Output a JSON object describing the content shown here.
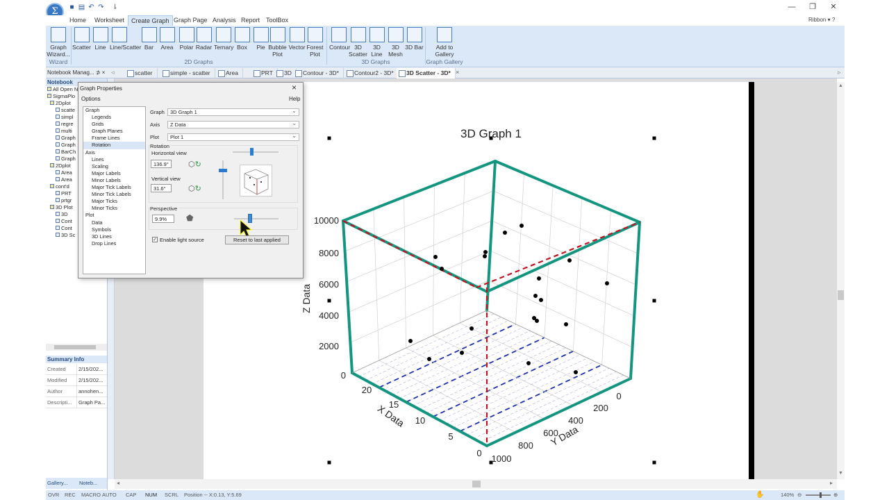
{
  "app": {
    "icon_glyph": "Σ",
    "ribbon_toggle": "Ribbon"
  },
  "menu": {
    "tabs": [
      "Home",
      "Worksheet",
      "Create Graph",
      "Graph Page",
      "Analysis",
      "Report",
      "ToolBox"
    ],
    "active": "Create Graph"
  },
  "ribbon": {
    "wizard_buttons": [
      {
        "label": "Graph Wizard...",
        "icon": "graph-wizard-icon"
      }
    ],
    "graph2d_buttons": [
      "Scatter",
      "Line",
      "Line/Scatter",
      "Bar",
      "Area",
      "Polar",
      "Radar",
      "Ternary",
      "Box",
      "Pie",
      "Bubble Plot",
      "Vector",
      "Forest Plot"
    ],
    "graph3d_buttons": [
      "Contour",
      "3D Scatter",
      "3D Line",
      "3D Mesh",
      "3D Bar"
    ],
    "gallery_buttons": [
      "Add to Gallery"
    ],
    "groups": {
      "wizard": "Wizard",
      "graph2d": "2D Graphs",
      "graph3d": "3D Graphs",
      "gallery": "Graph Gallery"
    }
  },
  "doc_tabs": {
    "pane_title": "Notebook Manag...",
    "pin": "⊅",
    "close": "×",
    "items": [
      "scatter",
      "simple - scatter",
      "Area",
      "PRT",
      "3D",
      "Contour - 3D*",
      "Contour2 - 3D*",
      "3D Scatter - 3D*"
    ],
    "active": "3D Scatter - 3D*"
  },
  "notebook": {
    "header": "Notebook",
    "items": [
      "All Open N",
      "SigmaPlo",
      "2Dplot",
      "scatte",
      "simpl",
      "regre",
      "multi",
      "Graph",
      "Graph",
      "BarCh",
      "Graph",
      "2Dplot",
      "Area",
      "Area",
      "cont'd",
      "PRT",
      "prtgr",
      "3D Plot",
      "3D",
      "Cont",
      "Cont",
      "3D Sc"
    ],
    "summary_header": "Summary Info",
    "summary": [
      {
        "k": "Created",
        "v": "2/15/202..."
      },
      {
        "k": "Modified",
        "v": "2/15/202..."
      },
      {
        "k": "Author",
        "v": "annohen..."
      },
      {
        "k": "Descripti...",
        "v": "Graph Pa..."
      }
    ],
    "bottom_tabs": [
      "Gallery...",
      "Noteb..."
    ]
  },
  "dialog": {
    "title": "Graph Properties",
    "options_label": "Options",
    "help_label": "Help",
    "close": "×",
    "tree": [
      "Graph",
      "Legends",
      "Grids",
      "Graph Planes",
      "Frame Lines",
      "Rotation",
      "Axis",
      "Lines",
      "Scaling",
      "Major Labels",
      "Minor Labels",
      "Major Tick Labels",
      "Minor Tick Labels",
      "Major Ticks",
      "Minor Ticks",
      "Plot",
      "Data",
      "Symbols",
      "3D Lines",
      "Drop Lines"
    ],
    "selected_tree_item": "Rotation",
    "graph_label": "Graph",
    "graph_value": "3D Graph 1",
    "axis_label": "Axis",
    "axis_value": "Z Data",
    "plot_label": "Plot",
    "plot_value": "Plot 1",
    "rotation_label": "Rotation",
    "horizontal_label": "Horizontal view",
    "horizontal_value": "136.9°",
    "vertical_label": "Vertical view",
    "vertical_value": "31.6°",
    "perspective_label": "Perspective",
    "perspective_value": "9.9%",
    "light_label": "Enable light source",
    "reset_label": "Reset to last applied",
    "horizontal_fraction": 0.38,
    "vertical_fraction": 0.36,
    "perspective_fraction": 0.1
  },
  "graph": {
    "title": "3D Graph 1",
    "zlabel": "Z Data",
    "xlabel": "X Data",
    "ylabel": "Y Data",
    "z_ticks": [
      "0",
      "2000",
      "4000",
      "6000",
      "8000",
      "10000"
    ],
    "x_ticks": [
      "0",
      "5",
      "10",
      "15",
      "20"
    ],
    "y_ticks": [
      "0",
      "200",
      "400",
      "600",
      "800",
      "1000"
    ]
  },
  "status": {
    "items": [
      "OVR",
      "REC",
      "MACRO",
      "AUTO",
      "CAP",
      "NUM",
      "SCRL",
      "Position -- X:0.13, Y:5.69"
    ],
    "zoom": "140%"
  },
  "colors": {
    "frame": "#14957f",
    "dashed_red": "#c0141f",
    "dashed_blue": "#1b2fb0",
    "ribbon_bg": "#dbe8f7",
    "accent": "#2b6cc4"
  }
}
